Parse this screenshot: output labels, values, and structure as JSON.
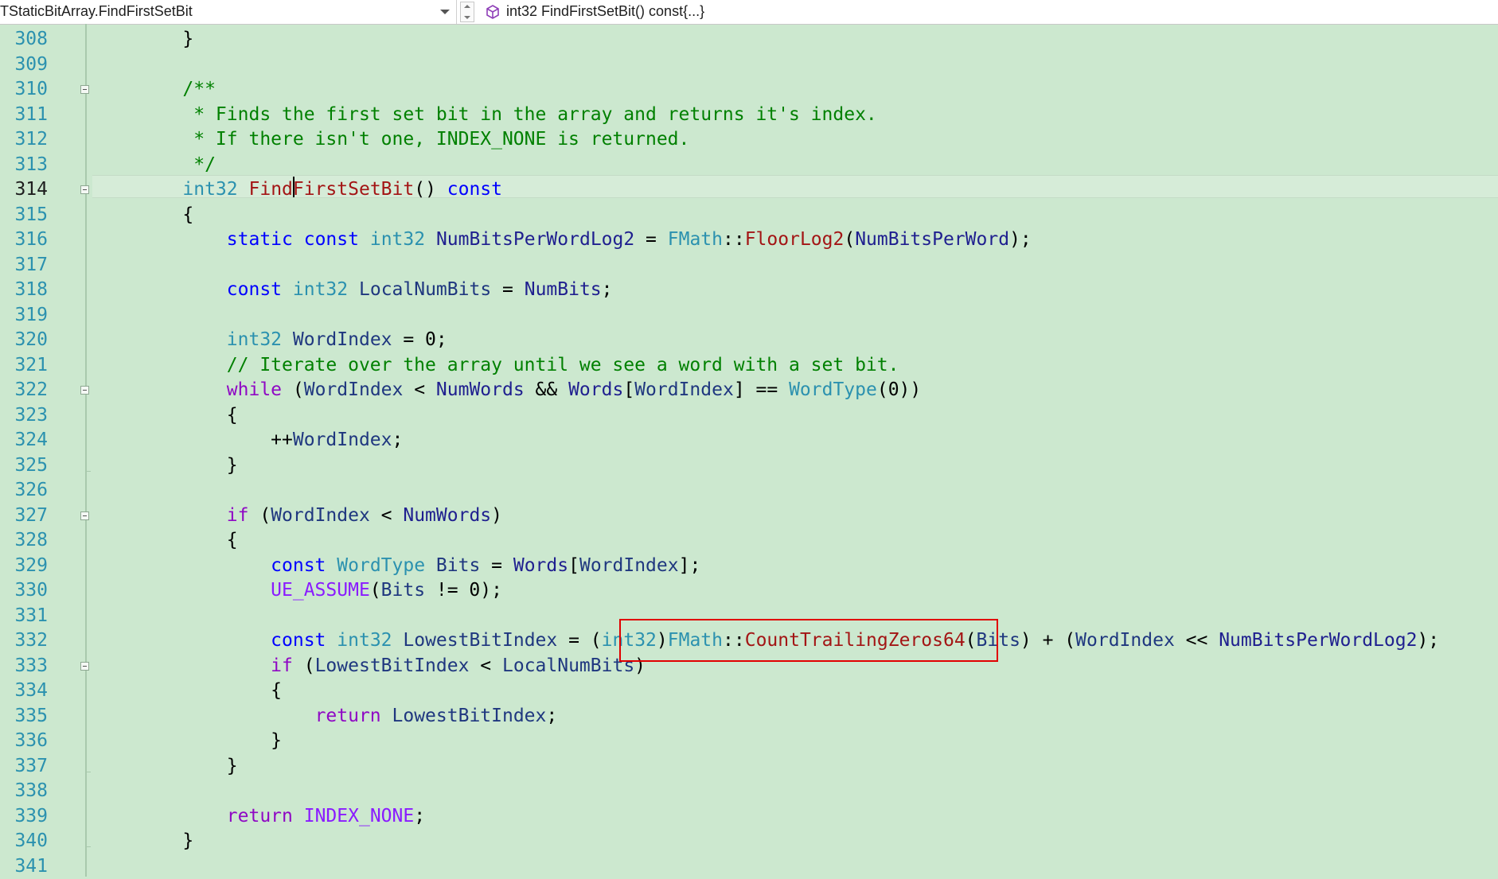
{
  "toolbar": {
    "scope": "TStaticBitArray.FindFirstSetBit",
    "member": "int32 FindFirstSetBit() const{...}",
    "member_icon": "cube-icon"
  },
  "current_line": "314",
  "lines": [
    {
      "n": "308",
      "tokens": [
        {
          "t": "    }",
          "c": ""
        }
      ]
    },
    {
      "n": "309",
      "tokens": []
    },
    {
      "n": "310",
      "tokens": [
        {
          "t": "    /**",
          "c": "cm"
        }
      ]
    },
    {
      "n": "311",
      "tokens": [
        {
          "t": "     * Finds the first set bit in the array and returns it's index.",
          "c": "cm"
        }
      ]
    },
    {
      "n": "312",
      "tokens": [
        {
          "t": "     * If there isn't one, INDEX_NONE is returned.",
          "c": "cm"
        }
      ]
    },
    {
      "n": "313",
      "tokens": [
        {
          "t": "     */",
          "c": "cm"
        }
      ]
    },
    {
      "n": "314",
      "tokens": [
        {
          "t": "    ",
          "c": ""
        },
        {
          "t": "int32",
          "c": "ty"
        },
        {
          "t": " ",
          "c": ""
        },
        {
          "t": "FindFirstSetBit",
          "c": "fr"
        },
        {
          "t": "() ",
          "c": ""
        },
        {
          "t": "const",
          "c": "kw"
        }
      ]
    },
    {
      "n": "315",
      "tokens": [
        {
          "t": "    {",
          "c": ""
        }
      ]
    },
    {
      "n": "316",
      "tokens": [
        {
          "t": "        ",
          "c": ""
        },
        {
          "t": "static",
          "c": "kw"
        },
        {
          "t": " ",
          "c": ""
        },
        {
          "t": "const",
          "c": "kw"
        },
        {
          "t": " ",
          "c": ""
        },
        {
          "t": "int32",
          "c": "ty"
        },
        {
          "t": " ",
          "c": ""
        },
        {
          "t": "NumBitsPerWordLog2",
          "c": "mb"
        },
        {
          "t": " = ",
          "c": ""
        },
        {
          "t": "FMath",
          "c": "ty"
        },
        {
          "t": "::",
          "c": ""
        },
        {
          "t": "FloorLog2",
          "c": "fr"
        },
        {
          "t": "(",
          "c": ""
        },
        {
          "t": "NumBitsPerWord",
          "c": "mb"
        },
        {
          "t": ");",
          "c": ""
        }
      ]
    },
    {
      "n": "317",
      "tokens": []
    },
    {
      "n": "318",
      "tokens": [
        {
          "t": "        ",
          "c": ""
        },
        {
          "t": "const",
          "c": "kw"
        },
        {
          "t": " ",
          "c": ""
        },
        {
          "t": "int32",
          "c": "ty"
        },
        {
          "t": " ",
          "c": ""
        },
        {
          "t": "LocalNumBits",
          "c": "vr"
        },
        {
          "t": " = ",
          "c": ""
        },
        {
          "t": "NumBits",
          "c": "mb"
        },
        {
          "t": ";",
          "c": ""
        }
      ]
    },
    {
      "n": "319",
      "tokens": []
    },
    {
      "n": "320",
      "tokens": [
        {
          "t": "        ",
          "c": ""
        },
        {
          "t": "int32",
          "c": "ty"
        },
        {
          "t": " ",
          "c": ""
        },
        {
          "t": "WordIndex",
          "c": "vr"
        },
        {
          "t": " = 0;",
          "c": ""
        }
      ]
    },
    {
      "n": "321",
      "tokens": [
        {
          "t": "        // Iterate over the array until we see a word with a set bit.",
          "c": "cm"
        }
      ]
    },
    {
      "n": "322",
      "tokens": [
        {
          "t": "        ",
          "c": ""
        },
        {
          "t": "while",
          "c": "kwc"
        },
        {
          "t": " (",
          "c": ""
        },
        {
          "t": "WordIndex",
          "c": "vr"
        },
        {
          "t": " < ",
          "c": ""
        },
        {
          "t": "NumWords",
          "c": "mb"
        },
        {
          "t": " && ",
          "c": ""
        },
        {
          "t": "Words",
          "c": "mb"
        },
        {
          "t": "[",
          "c": ""
        },
        {
          "t": "WordIndex",
          "c": "vr"
        },
        {
          "t": "] == ",
          "c": ""
        },
        {
          "t": "WordType",
          "c": "ty"
        },
        {
          "t": "(0))",
          "c": ""
        }
      ]
    },
    {
      "n": "323",
      "tokens": [
        {
          "t": "        {",
          "c": ""
        }
      ]
    },
    {
      "n": "324",
      "tokens": [
        {
          "t": "            ++",
          "c": ""
        },
        {
          "t": "WordIndex",
          "c": "vr"
        },
        {
          "t": ";",
          "c": ""
        }
      ]
    },
    {
      "n": "325",
      "tokens": [
        {
          "t": "        }",
          "c": ""
        }
      ]
    },
    {
      "n": "326",
      "tokens": []
    },
    {
      "n": "327",
      "tokens": [
        {
          "t": "        ",
          "c": ""
        },
        {
          "t": "if",
          "c": "kwc"
        },
        {
          "t": " (",
          "c": ""
        },
        {
          "t": "WordIndex",
          "c": "vr"
        },
        {
          "t": " < ",
          "c": ""
        },
        {
          "t": "NumWords",
          "c": "mb"
        },
        {
          "t": ")",
          "c": ""
        }
      ]
    },
    {
      "n": "328",
      "tokens": [
        {
          "t": "        {",
          "c": ""
        }
      ]
    },
    {
      "n": "329",
      "tokens": [
        {
          "t": "            ",
          "c": ""
        },
        {
          "t": "const",
          "c": "kw"
        },
        {
          "t": " ",
          "c": ""
        },
        {
          "t": "WordType",
          "c": "ty"
        },
        {
          "t": " ",
          "c": ""
        },
        {
          "t": "Bits",
          "c": "vr"
        },
        {
          "t": " = ",
          "c": ""
        },
        {
          "t": "Words",
          "c": "mb"
        },
        {
          "t": "[",
          "c": ""
        },
        {
          "t": "WordIndex",
          "c": "vr"
        },
        {
          "t": "];",
          "c": ""
        }
      ]
    },
    {
      "n": "330",
      "tokens": [
        {
          "t": "            ",
          "c": ""
        },
        {
          "t": "UE_ASSUME",
          "c": "mac"
        },
        {
          "t": "(",
          "c": ""
        },
        {
          "t": "Bits",
          "c": "vr"
        },
        {
          "t": " != 0);",
          "c": ""
        }
      ]
    },
    {
      "n": "331",
      "tokens": []
    },
    {
      "n": "332",
      "tokens": [
        {
          "t": "            ",
          "c": ""
        },
        {
          "t": "const",
          "c": "kw"
        },
        {
          "t": " ",
          "c": ""
        },
        {
          "t": "int32",
          "c": "ty"
        },
        {
          "t": " ",
          "c": ""
        },
        {
          "t": "LowestBitIndex",
          "c": "vr"
        },
        {
          "t": " = (",
          "c": ""
        },
        {
          "t": "int32",
          "c": "ty"
        },
        {
          "t": ")",
          "c": ""
        },
        {
          "t": "FMath",
          "c": "ty"
        },
        {
          "t": "::",
          "c": ""
        },
        {
          "t": "CountTrailingZeros64",
          "c": "fr"
        },
        {
          "t": "(",
          "c": ""
        },
        {
          "t": "Bits",
          "c": "vr"
        },
        {
          "t": ") + (",
          "c": ""
        },
        {
          "t": "WordIndex",
          "c": "vr"
        },
        {
          "t": " << ",
          "c": ""
        },
        {
          "t": "NumBitsPerWordLog2",
          "c": "mb"
        },
        {
          "t": ");",
          "c": ""
        }
      ]
    },
    {
      "n": "333",
      "tokens": [
        {
          "t": "            ",
          "c": ""
        },
        {
          "t": "if",
          "c": "kwc"
        },
        {
          "t": " (",
          "c": ""
        },
        {
          "t": "LowestBitIndex",
          "c": "vr"
        },
        {
          "t": " < ",
          "c": ""
        },
        {
          "t": "LocalNumBits",
          "c": "vr"
        },
        {
          "t": ")",
          "c": ""
        }
      ]
    },
    {
      "n": "334",
      "tokens": [
        {
          "t": "            {",
          "c": ""
        }
      ]
    },
    {
      "n": "335",
      "tokens": [
        {
          "t": "                ",
          "c": ""
        },
        {
          "t": "return",
          "c": "kwc"
        },
        {
          "t": " ",
          "c": ""
        },
        {
          "t": "LowestBitIndex",
          "c": "vr"
        },
        {
          "t": ";",
          "c": ""
        }
      ]
    },
    {
      "n": "336",
      "tokens": [
        {
          "t": "            }",
          "c": ""
        }
      ]
    },
    {
      "n": "337",
      "tokens": [
        {
          "t": "        }",
          "c": ""
        }
      ]
    },
    {
      "n": "338",
      "tokens": []
    },
    {
      "n": "339",
      "tokens": [
        {
          "t": "        ",
          "c": ""
        },
        {
          "t": "return",
          "c": "kwc"
        },
        {
          "t": " ",
          "c": ""
        },
        {
          "t": "INDEX_NONE",
          "c": "mac"
        },
        {
          "t": ";",
          "c": ""
        }
      ]
    },
    {
      "n": "340",
      "tokens": [
        {
          "t": "    }",
          "c": ""
        }
      ]
    },
    {
      "n": "341",
      "tokens": []
    }
  ],
  "fold_lines": [
    "310",
    "314",
    "322",
    "327",
    "333"
  ],
  "highlight": {
    "line": "332",
    "text": "FMath::CountTrailingZeros64(Bits)",
    "color": "#e00000"
  }
}
